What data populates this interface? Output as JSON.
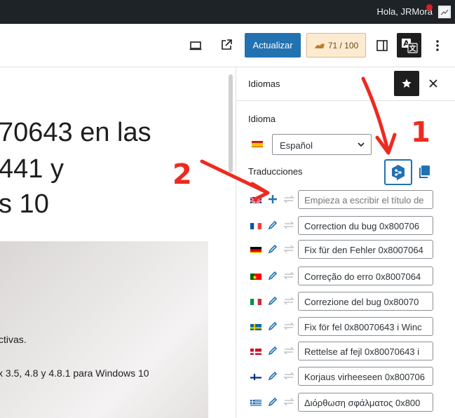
{
  "admin_bar": {
    "greeting": "Hola, JRMora"
  },
  "toolbar": {
    "update_label": "Actualizar",
    "score_label": "71 / 100",
    "icons": [
      "desktop-preview-icon",
      "external-link-icon",
      "sidebar-toggle-icon",
      "translate-icon",
      "more-options-icon"
    ]
  },
  "editor": {
    "title_lines": [
      "70643 en las",
      "441 y",
      "s 10"
    ],
    "image_text_lines": [
      "ctivas.",
      "x 3.5, 4.8 y 4.8.1 para Windows 10"
    ]
  },
  "sidebar": {
    "title": "Idiomas",
    "language_label": "Idioma",
    "language_value": "Español",
    "translations_label": "Traducciones",
    "translations": [
      {
        "flag": "gb",
        "action": "add",
        "value": "Empieza a escribir el título de",
        "placeholder": true
      },
      {
        "flag": "fr",
        "action": "edit",
        "value": "Correction du bug 0x800706"
      },
      {
        "flag": "de",
        "action": "edit",
        "value": "Fix für den Fehler 0x8007064"
      },
      {
        "flag": "pt",
        "action": "edit",
        "value": "Correção do erro 0x8007064"
      },
      {
        "flag": "it",
        "action": "edit",
        "value": "Correzione del bug 0x80070"
      },
      {
        "flag": "se",
        "action": "edit",
        "value": "Fix för fel 0x80070643 i Winc"
      },
      {
        "flag": "dk",
        "action": "edit",
        "value": "Rettelse af fejl 0x80070643 i"
      },
      {
        "flag": "fi",
        "action": "edit",
        "value": "Korjaus virheeseen 0x800706"
      },
      {
        "flag": "gr",
        "action": "edit",
        "value": "Διόρθωση σφάλματος 0x800"
      }
    ]
  },
  "annotations": {
    "label_1": "1",
    "label_2": "2"
  },
  "colors": {
    "accent": "#2271b1",
    "annotation": "#ee2a1f",
    "dark": "#1e1e1e"
  }
}
